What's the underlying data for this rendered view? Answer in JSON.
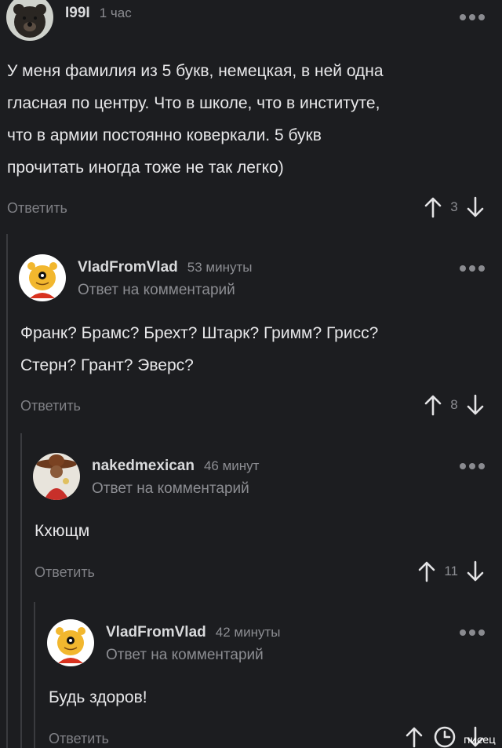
{
  "colors": {
    "background": "#1c1d20",
    "text": "#e7e7e9",
    "muted": "#8c8d92"
  },
  "comments": [
    {
      "author": "I99I",
      "time": "1 час",
      "text": "У меня фамилия из 5 букв, немецкая, в ней одна\nгласная по центру. Что в школе, что в институте,\nчто в армии постоянно коверкали. 5 букв\nпрочитать иногда тоже не так легко)",
      "reply_label": "Ответить",
      "votes": "3",
      "avatar_icon": "bear-avatar-icon"
    },
    {
      "author": "VladFromVlad",
      "time": "53 минуты",
      "reply_to": "Ответ на комментарий",
      "text": "Франк? Брамс? Брехт? Штарк? Гримм? Грисс?\nСтерн? Грант? Эверс?",
      "reply_label": "Ответить",
      "votes": "8",
      "avatar_icon": "pooh-avatar-icon"
    },
    {
      "author": "nakedmexican",
      "time": "46 минут",
      "reply_to": "Ответ на комментарий",
      "text": "Кхющм",
      "reply_label": "Ответить",
      "votes": "11",
      "avatar_icon": "mexican-avatar-icon"
    },
    {
      "author": "VladFromVlad",
      "time": "42 минуты",
      "reply_to": "Ответ на комментарий",
      "text": "Будь здоров!",
      "reply_label": "Ответить",
      "avatar_icon": "pooh-avatar-icon"
    }
  ],
  "watermark": "писец"
}
